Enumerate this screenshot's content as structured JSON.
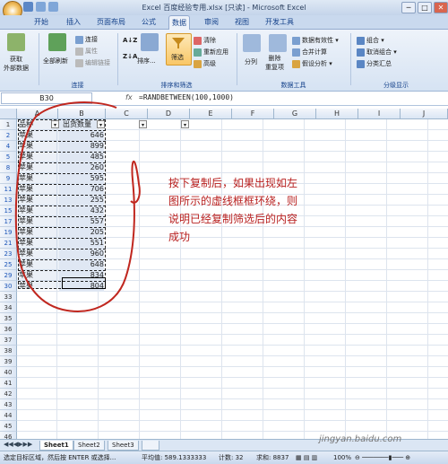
{
  "window": {
    "title": "Excel 百度经验专用.xlsx [只读] - Microsoft Excel",
    "controls": [
      "─",
      "□",
      "✕"
    ]
  },
  "ribbon_tabs": [
    "开始",
    "插入",
    "页面布局",
    "公式",
    "数据",
    "审阅",
    "视图",
    "开发工具"
  ],
  "ribbon": {
    "get_external": "获取\n外部数据",
    "refresh_all": "全部刷新",
    "connections": "连接",
    "properties": "属性",
    "edit_links": "编辑链接",
    "group_connect": "连接",
    "sort": "排序...",
    "filter": "筛选",
    "clear": "清除",
    "reapply": "重新应用",
    "advanced": "高级",
    "group_sortfilter": "排序和筛选",
    "text_to_columns": "分列",
    "remove_dup": "删除\n重复项",
    "validation": "数据有效性",
    "consolidate": "合并计算",
    "whatif": "假设分析",
    "group_datatools": "数据工具",
    "group": "组合",
    "ungroup": "取消组合",
    "subtotal": "分类汇总",
    "group_outline": "分级显示"
  },
  "formula_bar": {
    "name_box": "B30",
    "fx": "fx",
    "formula": "=RANDBETWEEN(100,1000)"
  },
  "columns": [
    "A",
    "B",
    "C",
    "D",
    "E",
    "F",
    "G",
    "H",
    "I",
    "J"
  ],
  "header_row": {
    "a": "品种",
    "b": "出货数量"
  },
  "rows": [
    {
      "num": "1",
      "a": "品种",
      "b": "出货数量"
    },
    {
      "num": "2",
      "a": "苹果",
      "b": "646"
    },
    {
      "num": "4",
      "a": "苹果",
      "b": "899"
    },
    {
      "num": "5",
      "a": "苹果",
      "b": "485"
    },
    {
      "num": "8",
      "a": "苹果",
      "b": "260"
    },
    {
      "num": "9",
      "a": "苹果",
      "b": "595"
    },
    {
      "num": "11",
      "a": "苹果",
      "b": "706"
    },
    {
      "num": "13",
      "a": "苹果",
      "b": "255"
    },
    {
      "num": "15",
      "a": "苹果",
      "b": "432"
    },
    {
      "num": "17",
      "a": "苹果",
      "b": "557"
    },
    {
      "num": "19",
      "a": "苹果",
      "b": "205"
    },
    {
      "num": "21",
      "a": "苹果",
      "b": "551"
    },
    {
      "num": "23",
      "a": "苹果",
      "b": "960"
    },
    {
      "num": "25",
      "a": "苹果",
      "b": "648"
    },
    {
      "num": "29",
      "a": "苹果",
      "b": "834"
    },
    {
      "num": "30",
      "a": "苹果",
      "b": "804"
    },
    {
      "num": "33"
    },
    {
      "num": "34"
    },
    {
      "num": "35"
    },
    {
      "num": "36"
    },
    {
      "num": "37"
    },
    {
      "num": "38"
    },
    {
      "num": "39"
    },
    {
      "num": "40"
    },
    {
      "num": "41"
    },
    {
      "num": "42"
    },
    {
      "num": "43"
    },
    {
      "num": "44"
    },
    {
      "num": "45"
    },
    {
      "num": "46"
    }
  ],
  "annotation": "按下复制后，如果出现如左图所示的虚线框框环绕，则说明已经复制筛选后的内容成功",
  "sheet_tabs": [
    "Sheet1",
    "Sheet2",
    "Sheet3"
  ],
  "status": {
    "message": "选定目标区域，然后按 ENTER 或选择...",
    "average": "平均值: 589.1333333",
    "count": "计数: 32",
    "sum": "求和: 8837",
    "zoom": "100%"
  },
  "watermark": "jingyan.baidu.com",
  "colors": {
    "accent": "#15428b",
    "annotation": "#b8201f",
    "row_filtered": "#1c55b8"
  }
}
